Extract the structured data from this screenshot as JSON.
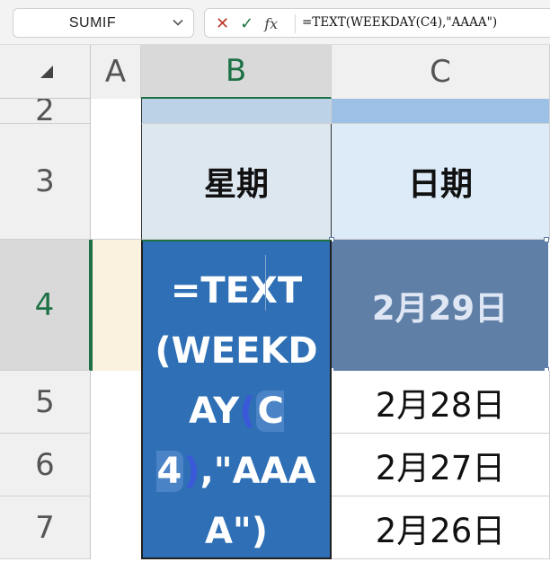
{
  "formula_bar": {
    "name_box": "SUMIF",
    "cancel_glyph": "✕",
    "enter_glyph": "✓",
    "fx_glyph": "fx",
    "formula": "=TEXT(WEEKDAY(C4),\"AAAA\")"
  },
  "columns": [
    "A",
    "B",
    "C"
  ],
  "rows": [
    "2",
    "3",
    "4",
    "5",
    "6",
    "7"
  ],
  "cells": {
    "B3": "星期",
    "C3": "日期",
    "C4": "2月29日",
    "C5": "2月28日",
    "C6": "2月27日",
    "C7": "2月26日"
  },
  "editing": {
    "cell": "B4",
    "part1": "=TEXT(WEEKDAY",
    "open_paren": "(",
    "ref": "C4",
    "close_paren": ")",
    "part2": ",\"AAAA\")"
  },
  "colors": {
    "edit_fill": "#2e6fb5",
    "selected_ref_fill": "#5f7fa6",
    "header_fill_c": "#ddeaf7",
    "row2_b_fill": "#bcd2e6",
    "row2_c_fill": "#9dc0e6",
    "accent_green": "#1e7145"
  },
  "icons": [
    "cancel-icon",
    "enter-icon",
    "function-icon",
    "chevron-down-icon",
    "select-all-icon"
  ]
}
